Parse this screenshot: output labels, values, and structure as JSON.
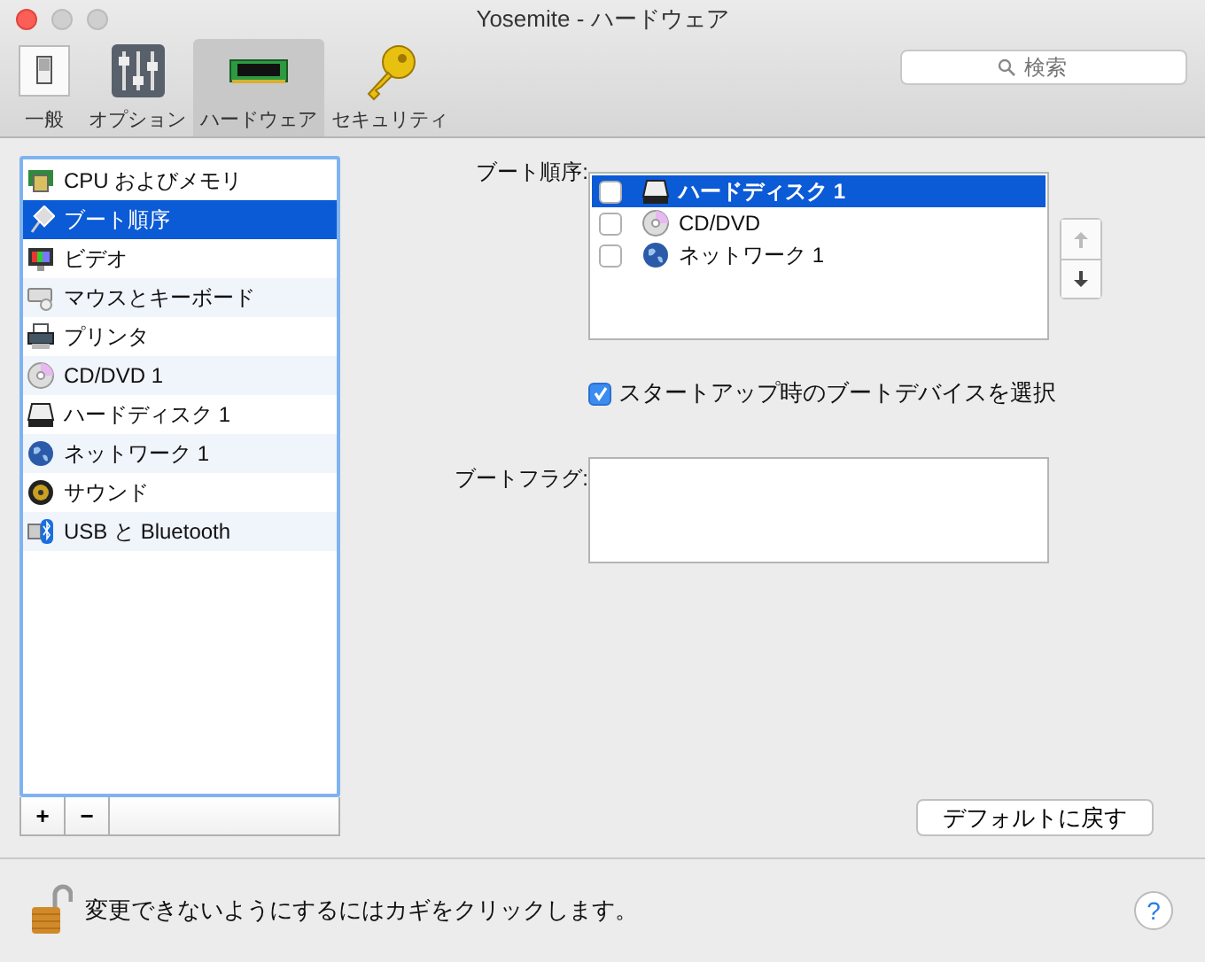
{
  "window": {
    "title": "Yosemite - ハードウェア"
  },
  "toolbar": [
    {
      "label": "一般",
      "kind": "general",
      "selected": false
    },
    {
      "label": "オプション",
      "kind": "options",
      "selected": false
    },
    {
      "label": "ハードウェア",
      "kind": "hardware",
      "selected": true
    },
    {
      "label": "セキュリティ",
      "kind": "security",
      "selected": false
    }
  ],
  "search": {
    "placeholder": "検索"
  },
  "sidebar": {
    "items": [
      {
        "label": "CPU およびメモリ",
        "kind": "memory",
        "selected": false
      },
      {
        "label": "ブート順序",
        "kind": "boot",
        "selected": true
      },
      {
        "label": "ビデオ",
        "kind": "video",
        "selected": false
      },
      {
        "label": "マウスとキーボード",
        "kind": "keyboard",
        "selected": false
      },
      {
        "label": "プリンタ",
        "kind": "printer",
        "selected": false
      },
      {
        "label": "CD/DVD 1",
        "kind": "disc",
        "selected": false
      },
      {
        "label": "ハードディスク 1",
        "kind": "harddisk",
        "selected": false
      },
      {
        "label": "ネットワーク 1",
        "kind": "network",
        "selected": false
      },
      {
        "label": "サウンド",
        "kind": "sound",
        "selected": false
      },
      {
        "label": "USB と Bluetooth",
        "kind": "usb",
        "selected": false
      }
    ],
    "add_button": "+",
    "remove_button": "−"
  },
  "boot_order": {
    "label": "ブート順序:",
    "items": [
      {
        "label": "ハードディスク 1",
        "kind": "harddisk",
        "checked": false,
        "selected": true
      },
      {
        "label": "CD/DVD",
        "kind": "disc",
        "checked": false,
        "selected": false
      },
      {
        "label": "ネットワーク 1",
        "kind": "network",
        "checked": false,
        "selected": false
      }
    ]
  },
  "startup_select": {
    "label": "スタートアップ時のブートデバイスを選択",
    "checked": true
  },
  "boot_flags": {
    "label": "ブートフラグ:"
  },
  "restore_button": "デフォルトに戻す",
  "lock": {
    "text": "変更できないようにするにはカギをクリックします。",
    "help": "?"
  }
}
